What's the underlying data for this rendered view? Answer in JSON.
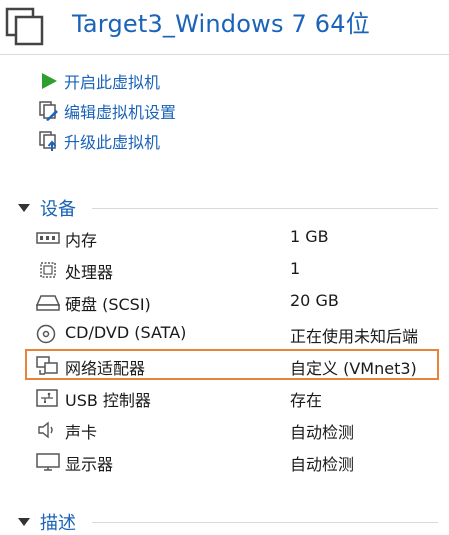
{
  "title": "Target3_Windows 7 64位",
  "actions": [
    {
      "label": "开启此虚拟机",
      "icon": "play-icon"
    },
    {
      "label": "编辑虚拟机设置",
      "icon": "edit-settings-icon"
    },
    {
      "label": "升级此虚拟机",
      "icon": "upgrade-icon"
    }
  ],
  "devices_section": {
    "title": "设备",
    "rows": [
      {
        "name": "内存",
        "value": "1 GB",
        "icon": "memory-icon"
      },
      {
        "name": "处理器",
        "value": "1",
        "icon": "processor-icon"
      },
      {
        "name": "硬盘 (SCSI)",
        "value": "20 GB",
        "icon": "hard-disk-icon"
      },
      {
        "name": "CD/DVD (SATA)",
        "value": "正在使用未知后端",
        "icon": "cd-dvd-icon"
      },
      {
        "name": "网络适配器",
        "value": "自定义 (VMnet3)",
        "icon": "network-adapter-icon"
      },
      {
        "name": "USB 控制器",
        "value": "存在",
        "icon": "usb-icon"
      },
      {
        "name": "声卡",
        "value": "自动检测",
        "icon": "speaker-icon"
      },
      {
        "name": "显示器",
        "value": "自动检测",
        "icon": "monitor-icon"
      }
    ]
  },
  "description_section": {
    "title": "描述"
  },
  "colors": {
    "accent": "#1a63b8",
    "highlight": "#e8833a",
    "play": "#2e9e2e"
  }
}
